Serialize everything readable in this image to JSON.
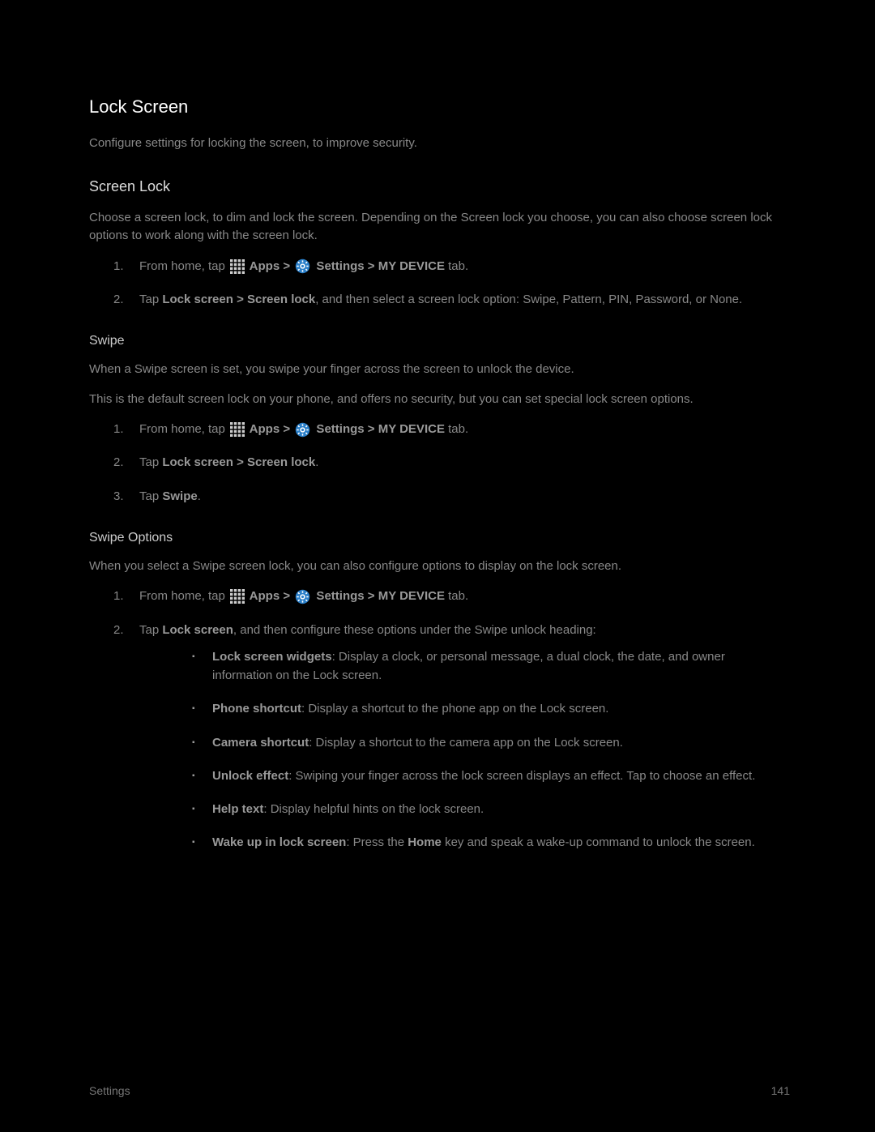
{
  "h1": "Lock Screen",
  "intro": "Configure settings for locking the screen, to improve security.",
  "h2_screen_lock": "Screen Lock",
  "screen_lock_para": "Choose a screen lock, to dim and lock the screen. Depending on the Screen lock you choose, you can also choose screen lock options to work along with the screen lock.",
  "ol1_step1_a": "From home, tap ",
  "apps_text": " Apps > ",
  "settings_text": " Settings > MY DEVICE",
  "tab_text": " tab.",
  "ol1_step2_a": "Tap ",
  "ol1_step2_b": "Lock screen > Screen lock",
  "ol1_step2_c": ", and then select a screen lock option: Swipe, Pattern, PIN, Password, or None.",
  "h3_swipe": "Swipe",
  "swipe_para1": "When a Swipe screen is set, you swipe your finger across the screen to unlock the device.",
  "swipe_para2": "This is the default screen lock on your phone, and offers no security, but you can set special lock screen options.",
  "ol2_step2_a": "Tap ",
  "ol2_step2_b": "Lock screen > Screen lock",
  "ol2_step2_c": ".",
  "ol2_step3_a": "Tap ",
  "ol2_step3_b": "Swipe",
  "ol2_step3_c": ".",
  "h3_swipe_opts": "Swipe Options",
  "swipe_opts_para": "When you select a Swipe screen lock, you can also configure options to display on the lock screen.",
  "ol3_step2_a": "Tap ",
  "ol3_step2_b": "Lock screen",
  "ol3_step2_c": ", and then configure these options under the Swipe unlock heading:",
  "b1_label": "Lock screen widgets",
  "b1_text": ": Display a clock, or personal message, a dual clock, the date, and owner information on the Lock screen.",
  "b2_label": "Phone shortcut",
  "b2_text": ": Display a shortcut to the phone app on the Lock screen.",
  "b3_label": "Camera shortcut",
  "b3_text": ": Display a shortcut to the camera app on the Lock screen.",
  "b4_label": "Unlock effect",
  "b4_text": ": Swiping your finger across the lock screen displays an effect. Tap to choose an effect.",
  "b5_label": "Help text",
  "b5_text": ": Display helpful hints on the lock screen.",
  "b6_label": "Wake up in lock screen",
  "b6_text_a": ": Press the ",
  "b6_text_b": "Home",
  "b6_text_c": " key and speak a wake-up command to unlock the screen.",
  "footer_left": "Settings",
  "footer_right": "141"
}
